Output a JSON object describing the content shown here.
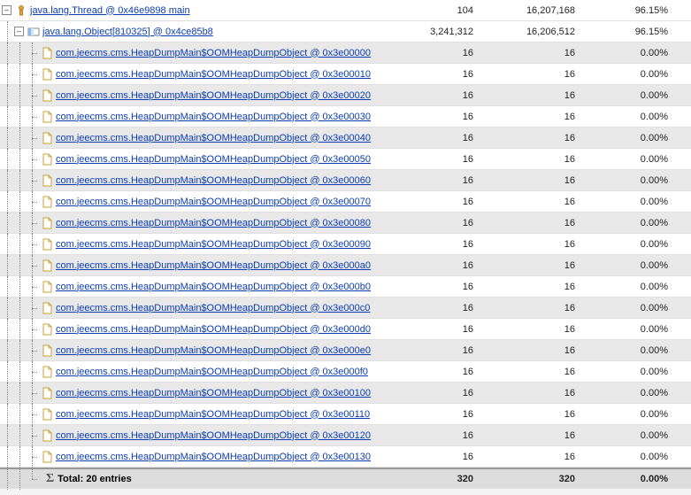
{
  "rows": [
    {
      "kind": "thread",
      "label": "java.lang.Thread @ 0x46e9898 main",
      "c1": "104",
      "c2": "16,207,168",
      "c3": "96.15%",
      "bg": "white",
      "indent": 0
    },
    {
      "kind": "array",
      "label": "java.lang.Object[810325] @ 0x4ce85b8",
      "c1": "3,241,312",
      "c2": "16,206,512",
      "c3": "96.15%",
      "bg": "white",
      "indent": 1
    },
    {
      "kind": "obj",
      "label": "com.jeecms.cms.HeapDumpMain$OOMHeapDumpObject @ 0x3e00000",
      "c1": "16",
      "c2": "16",
      "c3": "0.00%",
      "bg": "alt"
    },
    {
      "kind": "obj",
      "label": "com.jeecms.cms.HeapDumpMain$OOMHeapDumpObject @ 0x3e00010",
      "c1": "16",
      "c2": "16",
      "c3": "0.00%",
      "bg": "white"
    },
    {
      "kind": "obj",
      "label": "com.jeecms.cms.HeapDumpMain$OOMHeapDumpObject @ 0x3e00020",
      "c1": "16",
      "c2": "16",
      "c3": "0.00%",
      "bg": "alt"
    },
    {
      "kind": "obj",
      "label": "com.jeecms.cms.HeapDumpMain$OOMHeapDumpObject @ 0x3e00030",
      "c1": "16",
      "c2": "16",
      "c3": "0.00%",
      "bg": "white"
    },
    {
      "kind": "obj",
      "label": "com.jeecms.cms.HeapDumpMain$OOMHeapDumpObject @ 0x3e00040",
      "c1": "16",
      "c2": "16",
      "c3": "0.00%",
      "bg": "alt"
    },
    {
      "kind": "obj",
      "label": "com.jeecms.cms.HeapDumpMain$OOMHeapDumpObject @ 0x3e00050",
      "c1": "16",
      "c2": "16",
      "c3": "0.00%",
      "bg": "white"
    },
    {
      "kind": "obj",
      "label": "com.jeecms.cms.HeapDumpMain$OOMHeapDumpObject @ 0x3e00060",
      "c1": "16",
      "c2": "16",
      "c3": "0.00%",
      "bg": "alt"
    },
    {
      "kind": "obj",
      "label": "com.jeecms.cms.HeapDumpMain$OOMHeapDumpObject @ 0x3e00070",
      "c1": "16",
      "c2": "16",
      "c3": "0.00%",
      "bg": "white"
    },
    {
      "kind": "obj",
      "label": "com.jeecms.cms.HeapDumpMain$OOMHeapDumpObject @ 0x3e00080",
      "c1": "16",
      "c2": "16",
      "c3": "0.00%",
      "bg": "alt"
    },
    {
      "kind": "obj",
      "label": "com.jeecms.cms.HeapDumpMain$OOMHeapDumpObject @ 0x3e00090",
      "c1": "16",
      "c2": "16",
      "c3": "0.00%",
      "bg": "white"
    },
    {
      "kind": "obj",
      "label": "com.jeecms.cms.HeapDumpMain$OOMHeapDumpObject @ 0x3e000a0",
      "c1": "16",
      "c2": "16",
      "c3": "0.00%",
      "bg": "alt"
    },
    {
      "kind": "obj",
      "label": "com.jeecms.cms.HeapDumpMain$OOMHeapDumpObject @ 0x3e000b0",
      "c1": "16",
      "c2": "16",
      "c3": "0.00%",
      "bg": "white"
    },
    {
      "kind": "obj",
      "label": "com.jeecms.cms.HeapDumpMain$OOMHeapDumpObject @ 0x3e000c0",
      "c1": "16",
      "c2": "16",
      "c3": "0.00%",
      "bg": "alt"
    },
    {
      "kind": "obj",
      "label": "com.jeecms.cms.HeapDumpMain$OOMHeapDumpObject @ 0x3e000d0",
      "c1": "16",
      "c2": "16",
      "c3": "0.00%",
      "bg": "white"
    },
    {
      "kind": "obj",
      "label": "com.jeecms.cms.HeapDumpMain$OOMHeapDumpObject @ 0x3e000e0",
      "c1": "16",
      "c2": "16",
      "c3": "0.00%",
      "bg": "alt"
    },
    {
      "kind": "obj",
      "label": "com.jeecms.cms.HeapDumpMain$OOMHeapDumpObject @ 0x3e000f0",
      "c1": "16",
      "c2": "16",
      "c3": "0.00%",
      "bg": "white"
    },
    {
      "kind": "obj",
      "label": "com.jeecms.cms.HeapDumpMain$OOMHeapDumpObject @ 0x3e00100",
      "c1": "16",
      "c2": "16",
      "c3": "0.00%",
      "bg": "alt"
    },
    {
      "kind": "obj",
      "label": "com.jeecms.cms.HeapDumpMain$OOMHeapDumpObject @ 0x3e00110",
      "c1": "16",
      "c2": "16",
      "c3": "0.00%",
      "bg": "white"
    },
    {
      "kind": "obj",
      "label": "com.jeecms.cms.HeapDumpMain$OOMHeapDumpObject @ 0x3e00120",
      "c1": "16",
      "c2": "16",
      "c3": "0.00%",
      "bg": "alt"
    },
    {
      "kind": "obj",
      "label": "com.jeecms.cms.HeapDumpMain$OOMHeapDumpObject @ 0x3e00130",
      "c1": "16",
      "c2": "16",
      "c3": "0.00%",
      "bg": "white"
    }
  ],
  "total": {
    "label": "Total: 20 entries",
    "c1": "320",
    "c2": "320",
    "c3": "0.00%"
  },
  "icons": {
    "thread_svg": "<svg viewBox='0 0 14 14'><circle cx='7' cy='4' r='2.5' fill='#d9a44a' stroke='#b5821f'/><rect x='5.5' y='6' width='3' height='6' fill='#d9a44a' stroke='#b5821f'/></svg>",
    "array_svg": "<svg viewBox='0 0 14 14'><rect x='1' y='3' width='12' height='8' fill='#fff' stroke='#888'/><rect x='1' y='3' width='3' height='8' fill='#8bb6e8'/><rect x='4' y='3' width='3' height='8' fill='#d4e4f7'/></svg>",
    "obj_svg": "<svg viewBox='0 0 14 14'><path d='M3 1 h6 l3 3 v9 h-9 z' fill='#fff' stroke='#c9a23a'/><path d='M9 1 v3 h3' fill='none' stroke='#c9a23a'/></svg>"
  }
}
